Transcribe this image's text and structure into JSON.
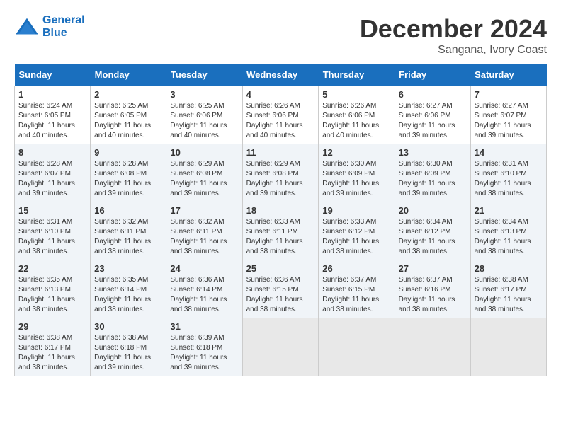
{
  "header": {
    "logo_line1": "General",
    "logo_line2": "Blue",
    "month_title": "December 2024",
    "location": "Sangana, Ivory Coast"
  },
  "weekdays": [
    "Sunday",
    "Monday",
    "Tuesday",
    "Wednesday",
    "Thursday",
    "Friday",
    "Saturday"
  ],
  "weeks": [
    [
      {
        "day": "1",
        "info": "Sunrise: 6:24 AM\nSunset: 6:05 PM\nDaylight: 11 hours\nand 40 minutes."
      },
      {
        "day": "2",
        "info": "Sunrise: 6:25 AM\nSunset: 6:05 PM\nDaylight: 11 hours\nand 40 minutes."
      },
      {
        "day": "3",
        "info": "Sunrise: 6:25 AM\nSunset: 6:06 PM\nDaylight: 11 hours\nand 40 minutes."
      },
      {
        "day": "4",
        "info": "Sunrise: 6:26 AM\nSunset: 6:06 PM\nDaylight: 11 hours\nand 40 minutes."
      },
      {
        "day": "5",
        "info": "Sunrise: 6:26 AM\nSunset: 6:06 PM\nDaylight: 11 hours\nand 40 minutes."
      },
      {
        "day": "6",
        "info": "Sunrise: 6:27 AM\nSunset: 6:06 PM\nDaylight: 11 hours\nand 39 minutes."
      },
      {
        "day": "7",
        "info": "Sunrise: 6:27 AM\nSunset: 6:07 PM\nDaylight: 11 hours\nand 39 minutes."
      }
    ],
    [
      {
        "day": "8",
        "info": "Sunrise: 6:28 AM\nSunset: 6:07 PM\nDaylight: 11 hours\nand 39 minutes."
      },
      {
        "day": "9",
        "info": "Sunrise: 6:28 AM\nSunset: 6:08 PM\nDaylight: 11 hours\nand 39 minutes."
      },
      {
        "day": "10",
        "info": "Sunrise: 6:29 AM\nSunset: 6:08 PM\nDaylight: 11 hours\nand 39 minutes."
      },
      {
        "day": "11",
        "info": "Sunrise: 6:29 AM\nSunset: 6:08 PM\nDaylight: 11 hours\nand 39 minutes."
      },
      {
        "day": "12",
        "info": "Sunrise: 6:30 AM\nSunset: 6:09 PM\nDaylight: 11 hours\nand 39 minutes."
      },
      {
        "day": "13",
        "info": "Sunrise: 6:30 AM\nSunset: 6:09 PM\nDaylight: 11 hours\nand 39 minutes."
      },
      {
        "day": "14",
        "info": "Sunrise: 6:31 AM\nSunset: 6:10 PM\nDaylight: 11 hours\nand 38 minutes."
      }
    ],
    [
      {
        "day": "15",
        "info": "Sunrise: 6:31 AM\nSunset: 6:10 PM\nDaylight: 11 hours\nand 38 minutes."
      },
      {
        "day": "16",
        "info": "Sunrise: 6:32 AM\nSunset: 6:11 PM\nDaylight: 11 hours\nand 38 minutes."
      },
      {
        "day": "17",
        "info": "Sunrise: 6:32 AM\nSunset: 6:11 PM\nDaylight: 11 hours\nand 38 minutes."
      },
      {
        "day": "18",
        "info": "Sunrise: 6:33 AM\nSunset: 6:11 PM\nDaylight: 11 hours\nand 38 minutes."
      },
      {
        "day": "19",
        "info": "Sunrise: 6:33 AM\nSunset: 6:12 PM\nDaylight: 11 hours\nand 38 minutes."
      },
      {
        "day": "20",
        "info": "Sunrise: 6:34 AM\nSunset: 6:12 PM\nDaylight: 11 hours\nand 38 minutes."
      },
      {
        "day": "21",
        "info": "Sunrise: 6:34 AM\nSunset: 6:13 PM\nDaylight: 11 hours\nand 38 minutes."
      }
    ],
    [
      {
        "day": "22",
        "info": "Sunrise: 6:35 AM\nSunset: 6:13 PM\nDaylight: 11 hours\nand 38 minutes."
      },
      {
        "day": "23",
        "info": "Sunrise: 6:35 AM\nSunset: 6:14 PM\nDaylight: 11 hours\nand 38 minutes."
      },
      {
        "day": "24",
        "info": "Sunrise: 6:36 AM\nSunset: 6:14 PM\nDaylight: 11 hours\nand 38 minutes."
      },
      {
        "day": "25",
        "info": "Sunrise: 6:36 AM\nSunset: 6:15 PM\nDaylight: 11 hours\nand 38 minutes."
      },
      {
        "day": "26",
        "info": "Sunrise: 6:37 AM\nSunset: 6:15 PM\nDaylight: 11 hours\nand 38 minutes."
      },
      {
        "day": "27",
        "info": "Sunrise: 6:37 AM\nSunset: 6:16 PM\nDaylight: 11 hours\nand 38 minutes."
      },
      {
        "day": "28",
        "info": "Sunrise: 6:38 AM\nSunset: 6:17 PM\nDaylight: 11 hours\nand 38 minutes."
      }
    ],
    [
      {
        "day": "29",
        "info": "Sunrise: 6:38 AM\nSunset: 6:17 PM\nDaylight: 11 hours\nand 38 minutes."
      },
      {
        "day": "30",
        "info": "Sunrise: 6:38 AM\nSunset: 6:18 PM\nDaylight: 11 hours\nand 39 minutes."
      },
      {
        "day": "31",
        "info": "Sunrise: 6:39 AM\nSunset: 6:18 PM\nDaylight: 11 hours\nand 39 minutes."
      },
      null,
      null,
      null,
      null
    ]
  ],
  "colors": {
    "header_bg": "#1a6fbe",
    "row_alt": "#f0f4f8",
    "empty_cell": "#e8e8e8"
  }
}
